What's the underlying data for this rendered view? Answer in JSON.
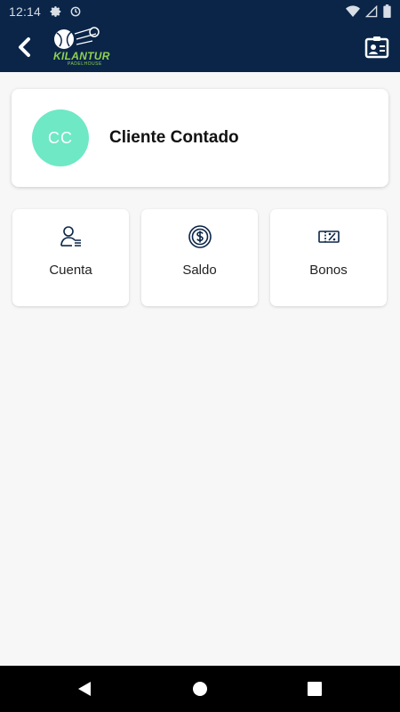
{
  "status_bar": {
    "time": "12:14",
    "icons": [
      "gear-icon",
      "sync-icon"
    ],
    "right_icons": [
      "wifi-icon",
      "signal-icon",
      "battery-icon"
    ]
  },
  "app_bar": {
    "logo_text": "KILANTUR",
    "logo_subtext": "PADELHOUSE",
    "back_icon": "chevron-left-icon",
    "action_icon": "id-card-icon"
  },
  "profile": {
    "initials": "CC",
    "name": "Cliente Contado",
    "avatar_color": "#6ee8c5"
  },
  "tiles": [
    {
      "label": "Cuenta",
      "icon": "user-list-icon"
    },
    {
      "label": "Saldo",
      "icon": "coin-icon"
    },
    {
      "label": "Bonos",
      "icon": "voucher-percent-icon"
    }
  ],
  "colors": {
    "header": "#0a2548",
    "background": "#f7f7f7",
    "accent": "#8fd14f"
  },
  "nav": [
    "back-triangle-icon",
    "home-circle-icon",
    "recents-square-icon"
  ]
}
